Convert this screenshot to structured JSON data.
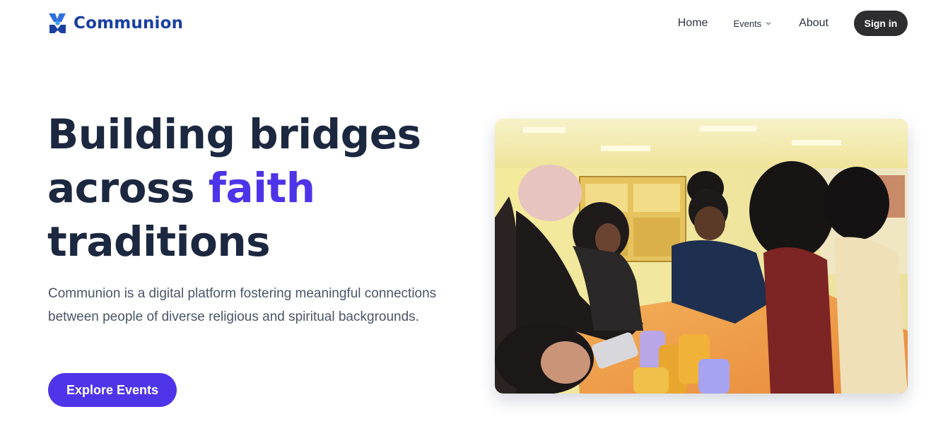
{
  "brand": {
    "name": "Communion",
    "colors": {
      "primary": "#1a3fa0",
      "secondary": "#2f6fe0",
      "accent": "#3aa3f0"
    }
  },
  "nav": {
    "items": [
      {
        "label": "Home"
      },
      {
        "label": "Events",
        "icon": "chevron-down-icon"
      },
      {
        "label": "About"
      }
    ],
    "signin_label": "Sign in"
  },
  "hero": {
    "title_line1": "Building bridges",
    "title_line2_prefix": "across ",
    "title_highlight": "faith",
    "title_line3": "traditions",
    "description": "Communion is a digital platform fostering meaningful connections between people of diverse religious and spiritual backgrounds.",
    "cta_label": "Explore Events",
    "image_alt": "people-in-classroom-photo"
  },
  "colors": {
    "heading": "#1c2740",
    "accent": "#4d34e8",
    "cta_bg": "#4f35ea",
    "signin_bg": "#2e2e30",
    "body_text": "#4a5568"
  }
}
